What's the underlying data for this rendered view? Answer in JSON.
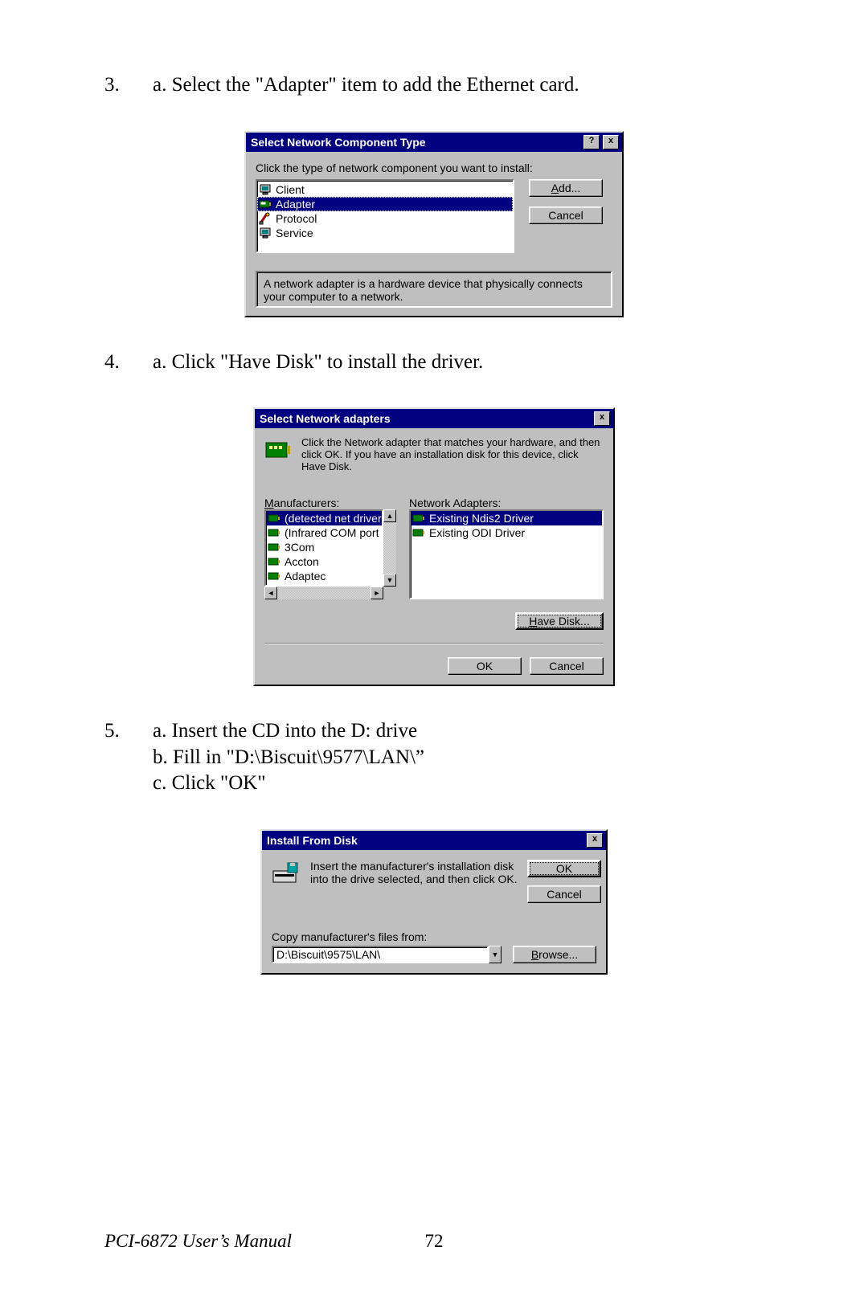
{
  "steps": {
    "s3": {
      "num": "3.",
      "lines": [
        "a. Select the \"Adapter\" item to add the Ethernet card."
      ]
    },
    "s4": {
      "num": "4.",
      "lines": [
        "a. Click \"Have Disk\" to install the driver."
      ]
    },
    "s5": {
      "num": "5.",
      "lines": [
        "a. Insert the CD into the D: drive",
        "b. Fill in \"D:\\Biscuit\\9577\\LAN\\”",
        "c. Click \"OK\""
      ]
    }
  },
  "dlg1": {
    "title": "Select Network Component Type",
    "help_glyph": "?",
    "close_glyph": "x",
    "instruction": "Click the type of network component you want to install:",
    "items": [
      {
        "name": "Client",
        "icon": "monitor"
      },
      {
        "name": "Adapter",
        "icon": "nic",
        "selected": true
      },
      {
        "name": "Protocol",
        "icon": "protocol"
      },
      {
        "name": "Service",
        "icon": "monitor"
      }
    ],
    "buttons": {
      "add": "Add...",
      "cancel": "Cancel"
    },
    "description": "A network adapter is a hardware device that physically connects your computer to a network."
  },
  "dlg2": {
    "title": "Select Network adapters",
    "close_glyph": "x",
    "instruction": "Click the Network adapter that matches your hardware, and then click OK. If you have an installation disk for this device, click Have Disk.",
    "labels": {
      "manufacturers": "Manufacturers:",
      "adapters": "Network Adapters:"
    },
    "manufacturers": [
      "(detected net drivers)",
      "(Infrared COM port or do",
      "3Com",
      "Accton",
      "Adaptec"
    ],
    "adapters": [
      "Existing Ndis2 Driver",
      "Existing ODI Driver"
    ],
    "buttons": {
      "havedisk": "Have Disk...",
      "ok": "OK",
      "cancel": "Cancel"
    }
  },
  "dlg3": {
    "title": "Install From Disk",
    "close_glyph": "x",
    "instruction": "Insert the manufacturer's installation disk into the drive selected, and then click OK.",
    "path_label": "Copy manufacturer's files from:",
    "path_value": "D:\\Biscuit\\9575\\LAN\\",
    "buttons": {
      "ok": "OK",
      "cancel": "Cancel",
      "browse": "Browse..."
    }
  },
  "footer": {
    "left": "PCI-6872 User’s Manual",
    "page": "72"
  }
}
